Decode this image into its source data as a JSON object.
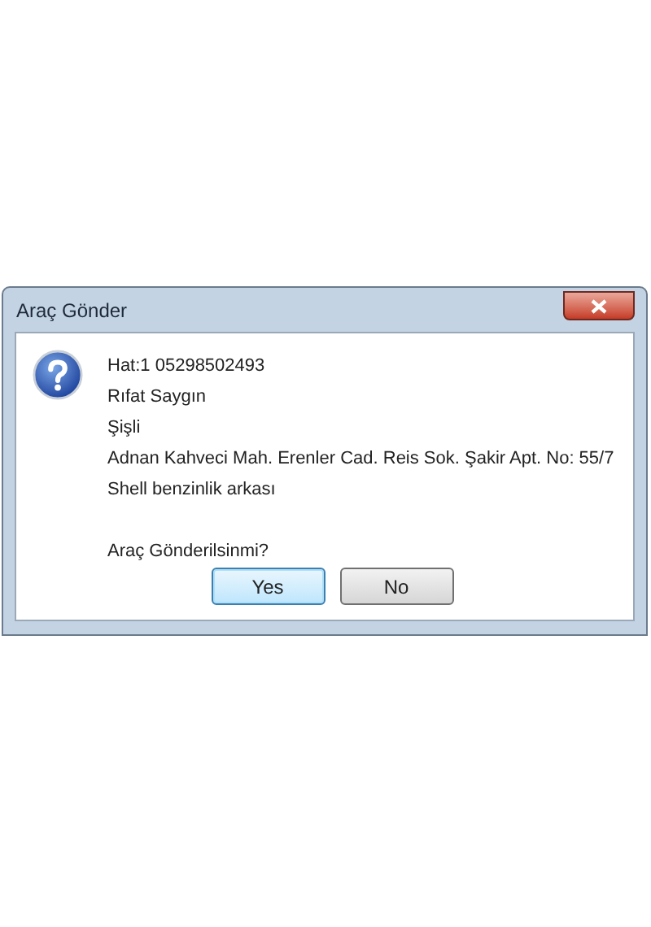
{
  "window": {
    "title": "Araç Gönder"
  },
  "message_lines": [
    "Hat:1 05298502493",
    "Rıfat Saygın",
    "Şişli",
    "Adnan Kahveci Mah. Erenler Cad. Reis Sok. Şakir Apt. No: 55/7",
    "Shell benzinlik arkası"
  ],
  "question": "Araç Gönderilsinmi?",
  "buttons": [
    {
      "label": "Yes",
      "default": true
    },
    {
      "label": "No",
      "default": false
    }
  ]
}
